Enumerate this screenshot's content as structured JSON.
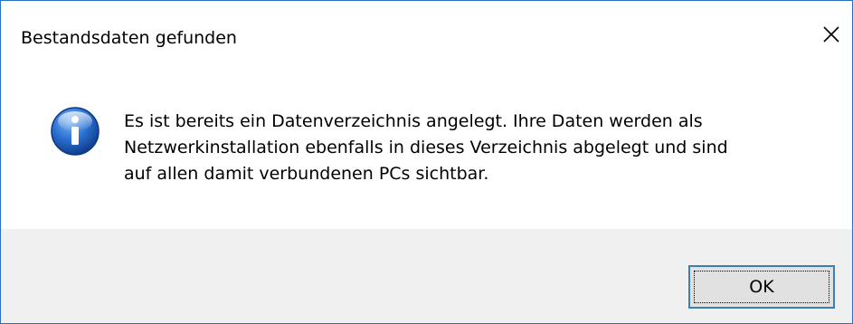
{
  "window": {
    "title": "Bestandsdaten gefunden",
    "close_icon": "close-icon",
    "border_color": "#2b6fbf"
  },
  "message": {
    "icon": "info-icon",
    "lines": [
      "Es ist bereits ein Datenverzeichnis angelegt. Ihre Daten werden als",
      "Netzwerkinstallation ebenfalls in dieses Verzeichnis abgelegt und sind",
      "auf allen damit verbundenen PCs sichtbar."
    ]
  },
  "buttons": {
    "ok_label": "OK"
  },
  "colors": {
    "footer_bg": "#f0f0f0",
    "button_bg": "#e1e1e1",
    "button_border": "#3c7fb1"
  }
}
